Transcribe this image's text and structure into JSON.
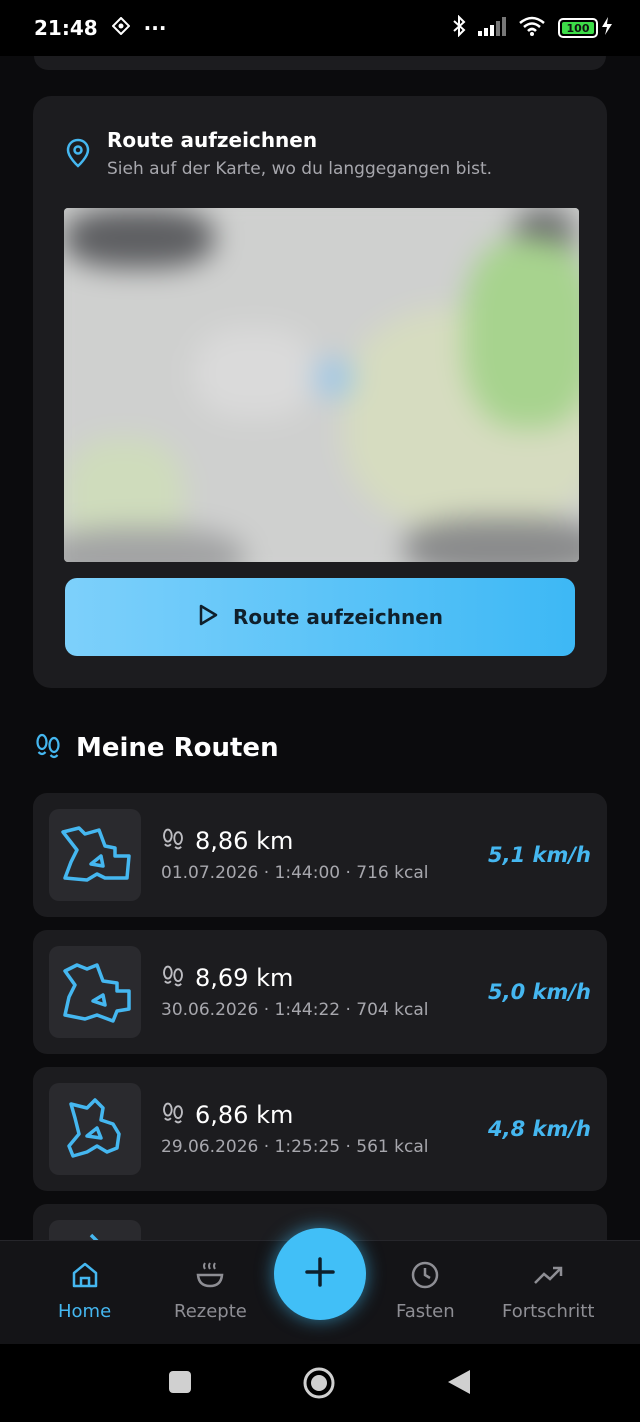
{
  "status_bar": {
    "time": "21:48",
    "dots": "···",
    "battery": "100"
  },
  "route_card": {
    "title": "Route aufzeichnen",
    "subtitle": "Sieh auf der Karte, wo du langgegangen bist.",
    "button_label": "Route aufzeichnen"
  },
  "routes_section": {
    "title": "Meine Routen",
    "items": [
      {
        "distance": "8,86 km",
        "meta": "01.07.2026 · 1:44:00 · 716 kcal",
        "speed": "5,1 km/h"
      },
      {
        "distance": "8,69 km",
        "meta": "30.06.2026 · 1:44:22 · 704 kcal",
        "speed": "5,0 km/h"
      },
      {
        "distance": "6,86 km",
        "meta": "29.06.2026 · 1:25:25 · 561 kcal",
        "speed": "4,8 km/h"
      }
    ]
  },
  "bottom_nav": {
    "home": "Home",
    "recipes": "Rezepte",
    "fasting": "Fasten",
    "progress": "Fortschritt"
  },
  "colors": {
    "accent": "#45b7f0",
    "card": "#1c1c1f",
    "background": "#0b0b0d"
  }
}
